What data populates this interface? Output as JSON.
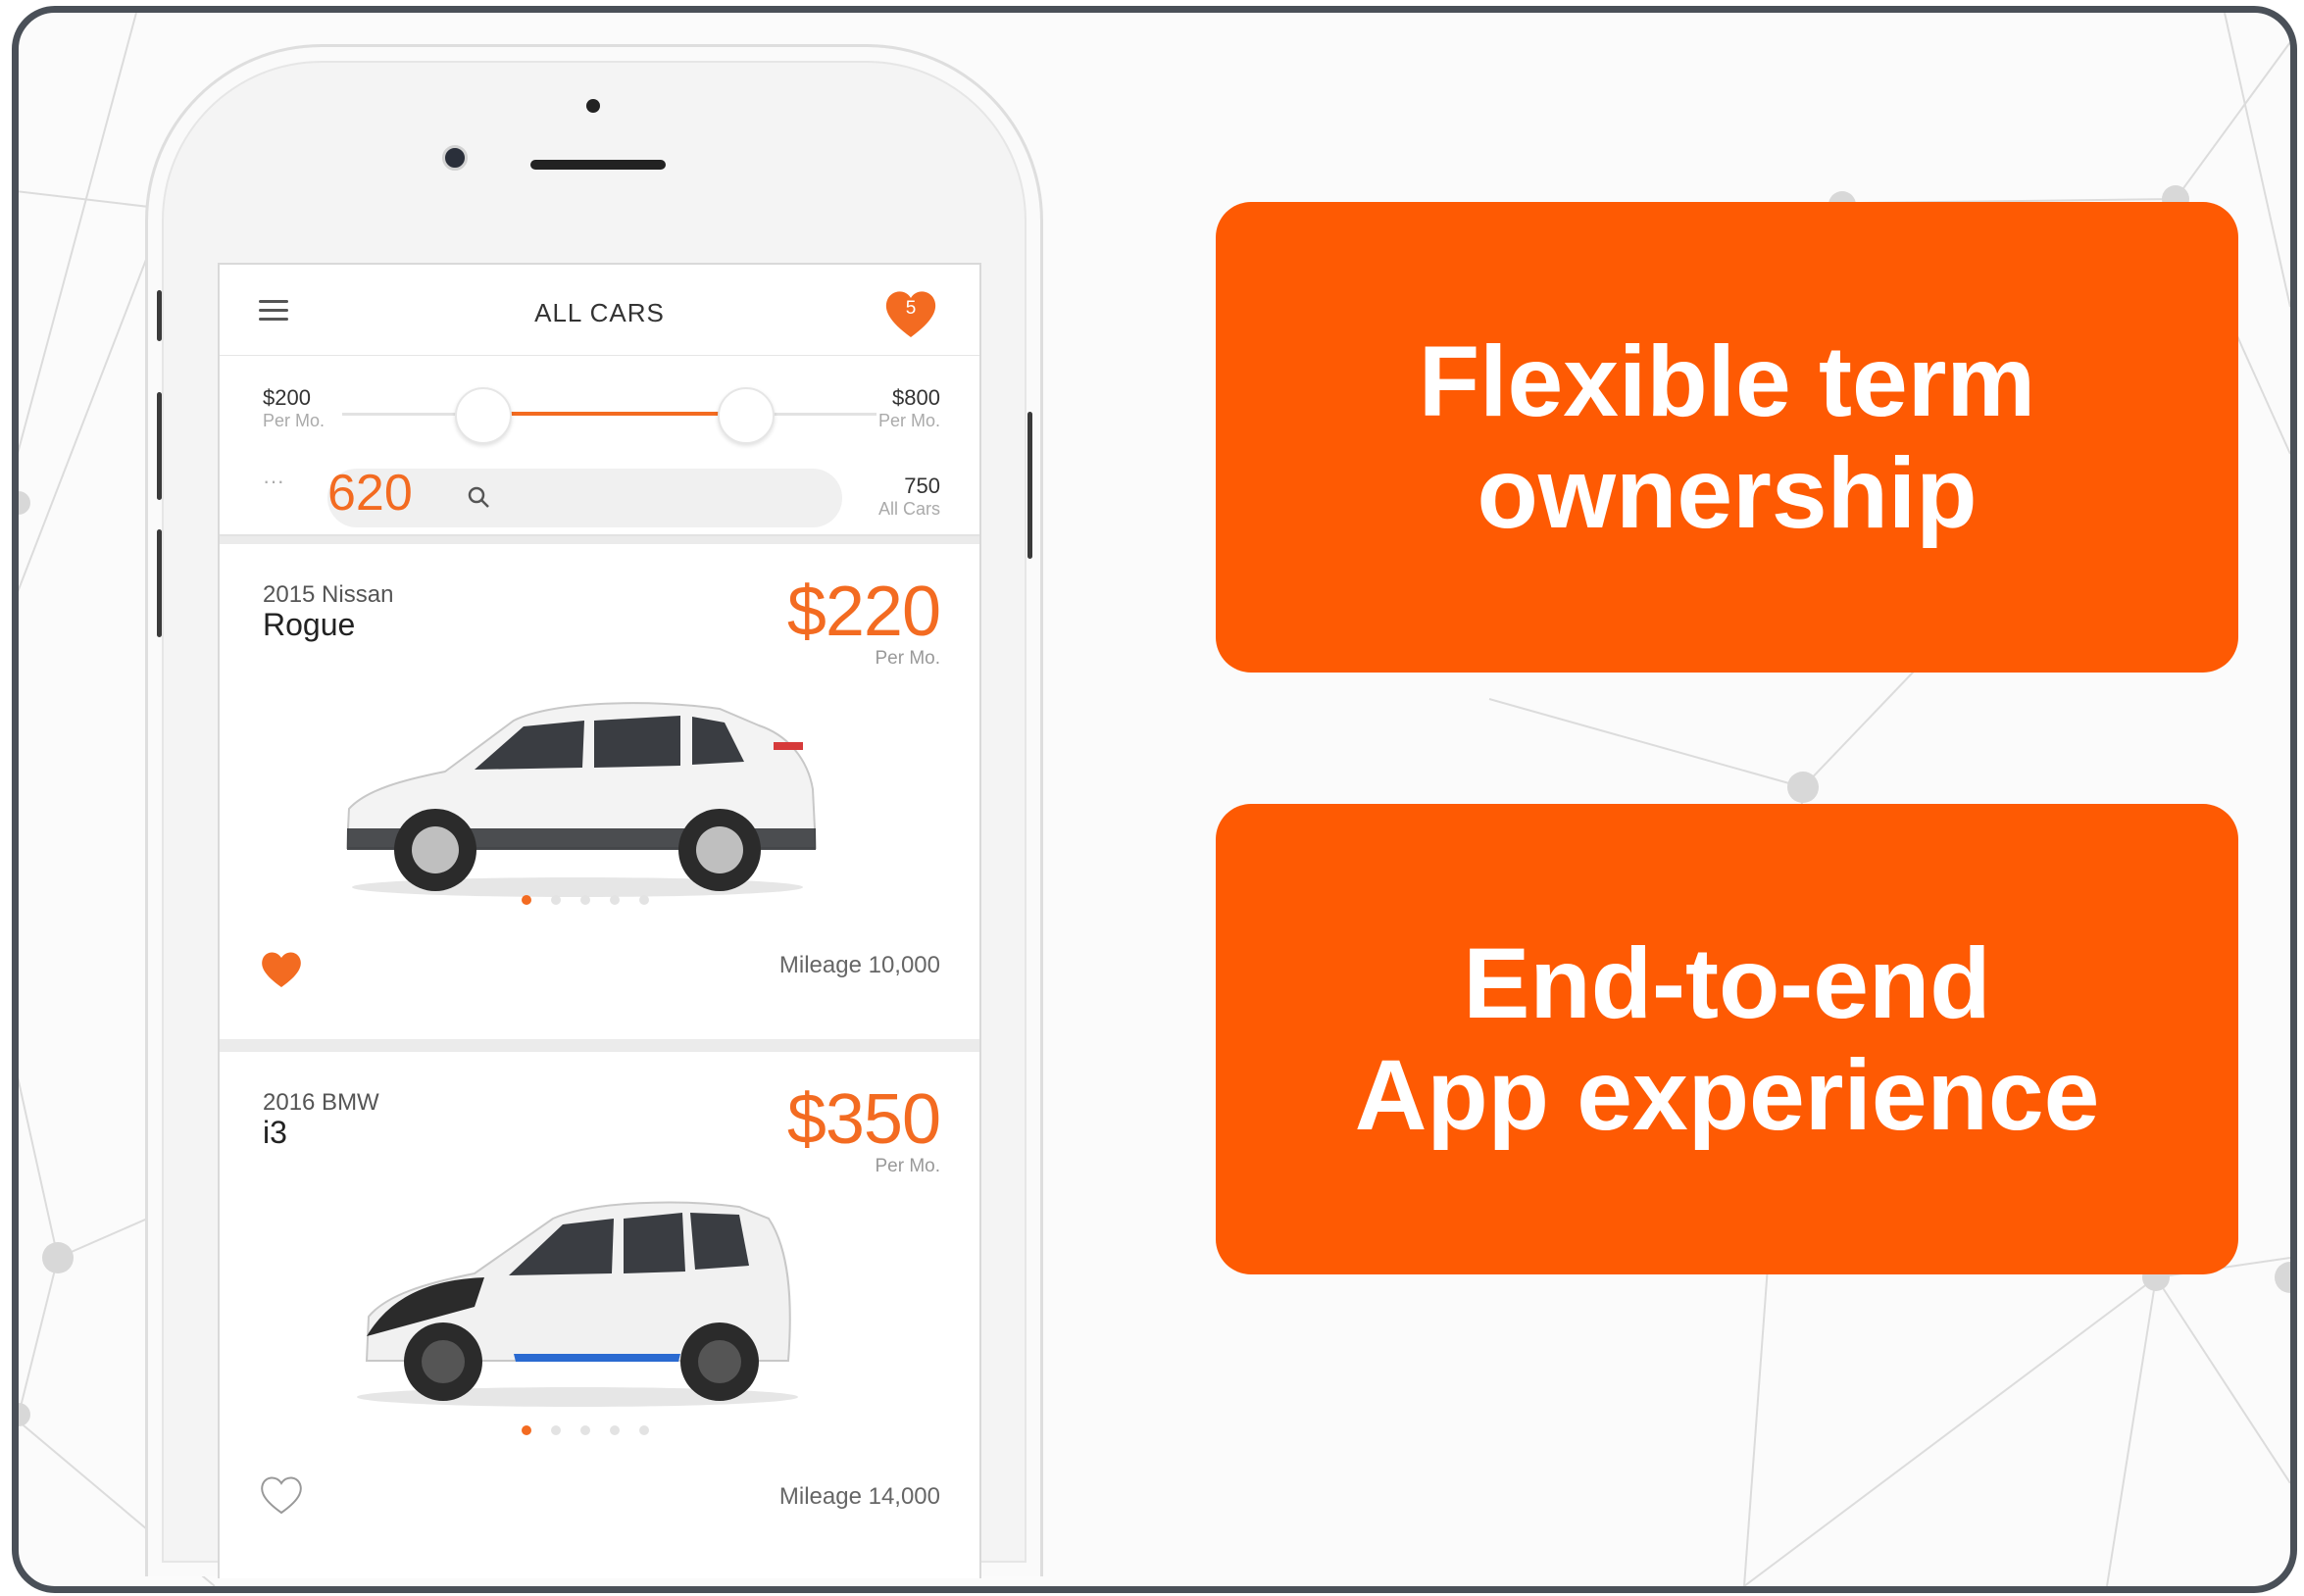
{
  "colors": {
    "accent": "#fe5a03",
    "app_orange": "#f36b21",
    "frame": "#4a5058"
  },
  "app": {
    "title": "ALL CARS",
    "favorites_count": "5",
    "filter": {
      "min_price": "$200",
      "min_unit": "Per Mo.",
      "max_price": "$800",
      "max_unit": "Per Mo.",
      "results_count": "620",
      "ellipsis": "···",
      "total_count": "750",
      "total_label": "All Cars"
    },
    "cars": [
      {
        "make": "2015 Nissan",
        "model": "Rogue",
        "price": "$220",
        "price_unit": "Per Mo.",
        "mileage": "Mileage 10,000",
        "favorited": true
      },
      {
        "make": "2016 BMW",
        "model": "i3",
        "price": "$350",
        "price_unit": "Per Mo.",
        "mileage": "Mileage 14,000",
        "favorited": false
      }
    ]
  },
  "features": [
    {
      "line1": "Flexible term",
      "line2": "ownership"
    },
    {
      "line1": "End-to-end",
      "line2": "App experience"
    }
  ],
  "icons": [
    "menu-icon",
    "heart-icon",
    "search-icon",
    "heart-outline-icon"
  ]
}
